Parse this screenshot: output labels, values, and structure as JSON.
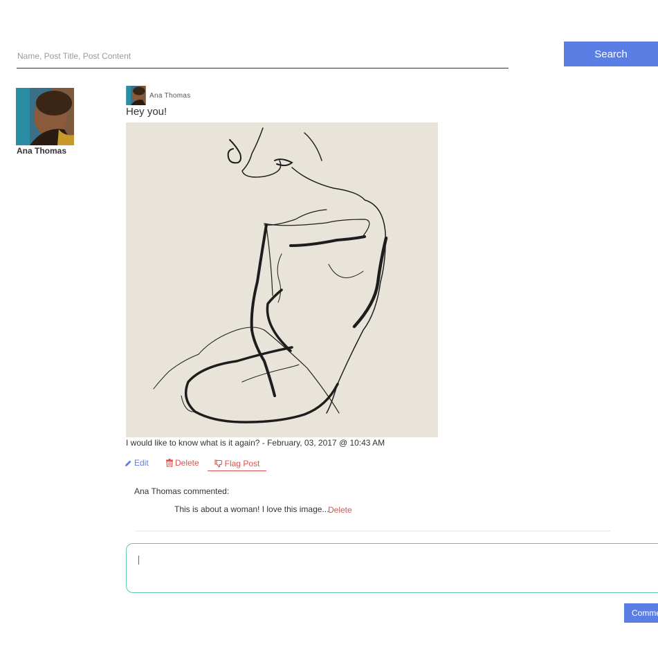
{
  "search": {
    "placeholder": "Name, Post Title, Post Content",
    "value": "",
    "button_label": "Search"
  },
  "profile": {
    "name": "Ana Thomas"
  },
  "post": {
    "author": "Ana Thomas",
    "title": "Hey you!",
    "caption": "I would like to know what is it again? - February, 03, 2017 @ 10:43 AM",
    "actions": {
      "edit": "Edit",
      "delete": "Delete",
      "flag": "Flag Post"
    }
  },
  "comments": [
    {
      "header": "Ana Thomas commented:",
      "text": "This is about a woman! I love this image...",
      "delete_label": "Delete"
    }
  ],
  "comment_form": {
    "value": "",
    "button_label": "Comment"
  },
  "colors": {
    "primary": "#5b7ee5",
    "danger": "#d9534f",
    "focus_border": "#5fc9b4"
  },
  "icons": [
    "pencil-icon",
    "trash-icon",
    "thumbs-down-icon"
  ]
}
